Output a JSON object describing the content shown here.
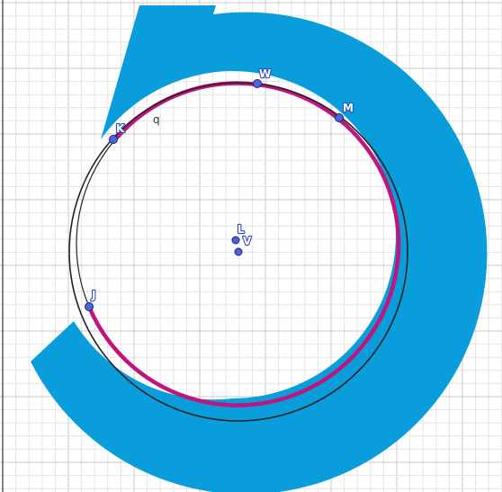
{
  "colors": {
    "ring": "#0a9ddb",
    "arc": "#c0157c",
    "circle_outline": "#222222",
    "point_fill": "#4b64d8",
    "grid_minor": "#e4e4e4",
    "grid_major": "#c8c8c8"
  },
  "points": [
    {
      "id": "W",
      "label": "W"
    },
    {
      "id": "M",
      "label": "M"
    },
    {
      "id": "K",
      "label": "K"
    },
    {
      "id": "J",
      "label": "J"
    },
    {
      "id": "L",
      "label": "L"
    },
    {
      "id": "V",
      "label": "V"
    }
  ],
  "curve_label": "q"
}
